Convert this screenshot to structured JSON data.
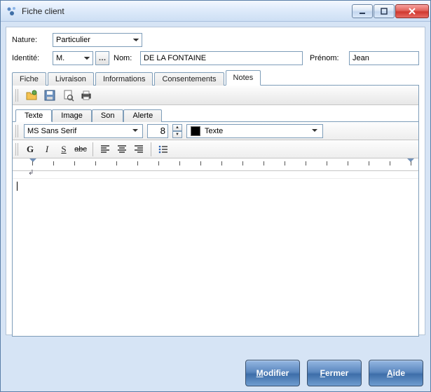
{
  "window": {
    "title": "Fiche client"
  },
  "form": {
    "nature_label": "Nature:",
    "nature_value": "Particulier",
    "identite_label": "Identité:",
    "identite_value": "M.",
    "nom_label": "Nom:",
    "nom_value": "DE LA FONTAINE",
    "prenom_label": "Prénom:",
    "prenom_value": "Jean"
  },
  "main_tabs": [
    {
      "label": "Fiche"
    },
    {
      "label": "Livraison"
    },
    {
      "label": "Informations"
    },
    {
      "label": "Consentements"
    },
    {
      "label": "Notes"
    }
  ],
  "sub_tabs": [
    {
      "label": "Texte"
    },
    {
      "label": "Image"
    },
    {
      "label": "Son"
    },
    {
      "label": "Alerte"
    }
  ],
  "toolbar_icons": [
    {
      "name": "open-folder-icon"
    },
    {
      "name": "save-icon"
    },
    {
      "name": "print-preview-icon"
    },
    {
      "name": "print-icon"
    }
  ],
  "font_row": {
    "font_name": "MS Sans Serif",
    "font_size": "8",
    "attribute_label": "Texte",
    "color_hex": "#000000"
  },
  "format_row": {
    "bold": "G",
    "italic": "I",
    "underline": "S",
    "strike": "abc"
  },
  "editor_content": "",
  "buttons": {
    "modifier": "Modifier",
    "fermer": "Fermer",
    "aide": "Aide",
    "modifier_mn": "M",
    "fermer_mn": "F",
    "aide_mn": "A"
  }
}
